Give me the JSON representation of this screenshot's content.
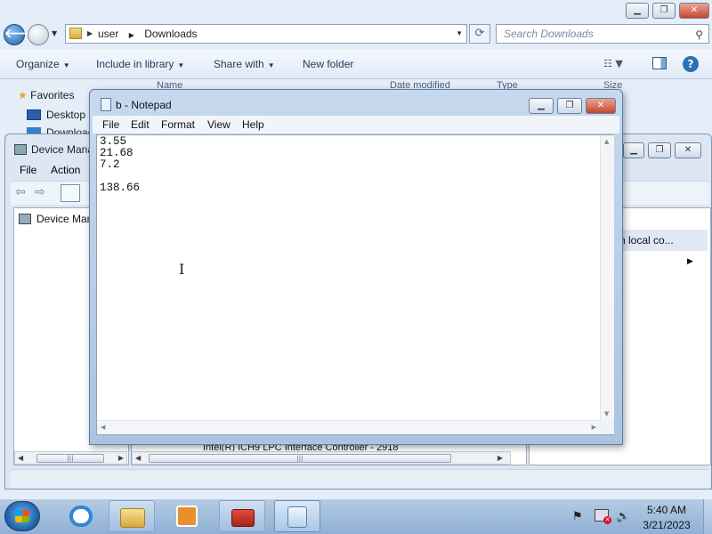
{
  "explorer": {
    "caption_buttons": [
      "▁",
      "❐",
      "✕"
    ],
    "address": {
      "crumbs": [
        "user",
        "Downloads"
      ]
    },
    "search_placeholder": "Search Downloads",
    "commands": [
      "Organize",
      "Include in library",
      "Share with",
      "New folder"
    ],
    "nav": {
      "favorites": "Favorites",
      "desktop": "Desktop",
      "downloads": "Downloads"
    },
    "columns": [
      "Name",
      "Date modified",
      "Type",
      "Size"
    ]
  },
  "device_manager": {
    "title": "Device Manager",
    "menu": [
      "File",
      "Action"
    ],
    "tree_root": "Device Manager on local computer",
    "right_header": "n local co...",
    "partial_row": "Intel(R) ICH9 LPC Interface Controller - 2918"
  },
  "notepad": {
    "title": "b - Notepad",
    "menu": [
      "File",
      "Edit",
      "Format",
      "View",
      "Help"
    ],
    "content": "3.55\n21.68\n7.2\n\n138.66"
  },
  "taskbar": {
    "time": "5:40 AM",
    "date": "3/21/2023",
    "pinned": [
      "internet-explorer",
      "explorer",
      "media-player",
      "device-manager",
      "notepad"
    ]
  },
  "colors": {
    "taskbar": "#8fb0d4",
    "window_frame": "#a9c4e2",
    "close_red": "#c6452d"
  }
}
